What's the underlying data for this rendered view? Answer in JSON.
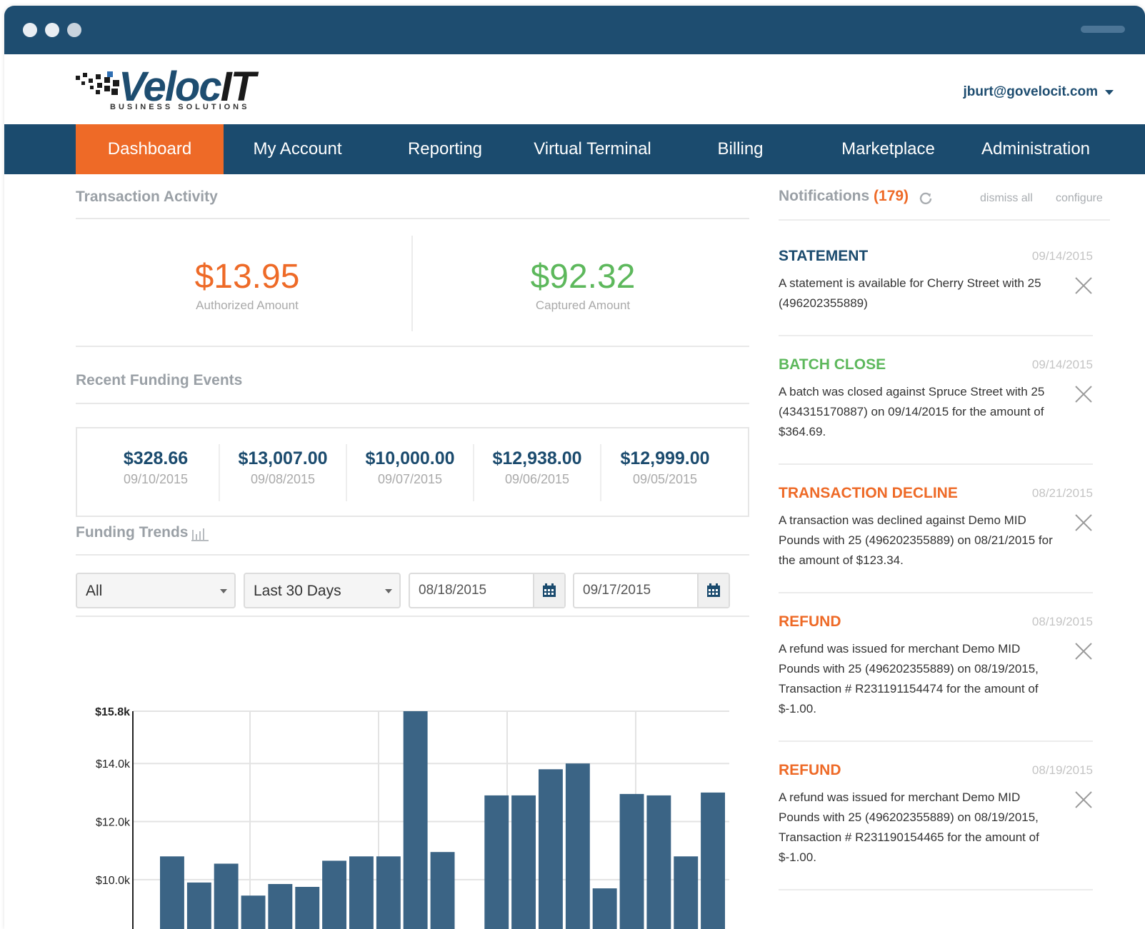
{
  "header": {
    "logo": {
      "name": "VelocIT",
      "part1": "Veloc",
      "part2": "IT",
      "subtitle": "BUSINESS SOLUTIONS"
    },
    "user_email": "jburt@govelocit.com"
  },
  "nav": {
    "items": [
      {
        "label": "Dashboard",
        "active": true
      },
      {
        "label": "My Account"
      },
      {
        "label": "Reporting"
      },
      {
        "label": "Virtual Terminal"
      },
      {
        "label": "Billing"
      },
      {
        "label": "Marketplace"
      },
      {
        "label": "Administration"
      }
    ]
  },
  "activity": {
    "title": "Transaction Activity",
    "authorized": {
      "amount": "$13.95",
      "label": "Authorized Amount"
    },
    "captured": {
      "amount": "$92.32",
      "label": "Captured Amount"
    }
  },
  "funding": {
    "title": "Recent Funding Events",
    "events": [
      {
        "amount": "$328.66",
        "date": "09/10/2015"
      },
      {
        "amount": "$13,007.00",
        "date": "09/08/2015"
      },
      {
        "amount": "$10,000.00",
        "date": "09/07/2015"
      },
      {
        "amount": "$12,938.00",
        "date": "09/06/2015"
      },
      {
        "amount": "$12,999.00",
        "date": "09/05/2015"
      }
    ]
  },
  "trends": {
    "title": "Funding Trends",
    "filter_select": "All",
    "range_select": "Last 30 Days",
    "start_date": "08/18/2015",
    "end_date": "09/17/2015"
  },
  "chart_data": {
    "type": "bar",
    "ylim": [
      8300,
      15800
    ],
    "ytick_labels": [
      "$15.8k",
      "$14.0k",
      "$12.0k",
      "$10.0k"
    ],
    "yticks": [
      15800,
      14000,
      12000,
      10000
    ],
    "grid": true,
    "values": [
      10800,
      9900,
      10550,
      9450,
      9850,
      9750,
      10650,
      10800,
      10800,
      15800,
      10950,
      0,
      12900,
      12900,
      13800,
      14000,
      9700,
      12950,
      12900,
      10800,
      13000
    ],
    "color": "#3b6485"
  },
  "notifications": {
    "title": "Notifications",
    "count": "(179)",
    "dismiss_label": "dismiss all",
    "configure_label": "configure",
    "items": [
      {
        "type": "STATEMENT",
        "color": "#1b4b6e",
        "date": "09/14/2015",
        "body": "A statement is available for Cherry Street with 25 (496202355889)"
      },
      {
        "type": "BATCH CLOSE",
        "color": "#5db85c",
        "date": "09/14/2015",
        "body": "A batch was closed against Spruce Street with 25 (434315170887) on 09/14/2015 for the amount of $364.69."
      },
      {
        "type": "TRANSACTION DECLINE",
        "color": "#ee6a27",
        "date": "08/21/2015",
        "body": "A transaction was declined against Demo MID Pounds with 25 (496202355889) on 08/21/2015 for the amount of $123.34."
      },
      {
        "type": "REFUND",
        "color": "#ee6a27",
        "date": "08/19/2015",
        "body": "A refund was issued for merchant Demo MID Pounds with 25 (496202355889) on 08/19/2015, Transaction # R231191154474 for the amount of $-1.00."
      },
      {
        "type": "REFUND",
        "color": "#ee6a27",
        "date": "08/19/2015",
        "body": "A refund was issued for merchant Demo MID Pounds with 25 (496202355889) on 08/19/2015, Transaction # R231190154465 for the amount of $-1.00."
      }
    ]
  },
  "colors": {
    "brand_blue": "#1b4b6e",
    "accent_orange": "#ee6a27",
    "success_green": "#5db85c"
  }
}
